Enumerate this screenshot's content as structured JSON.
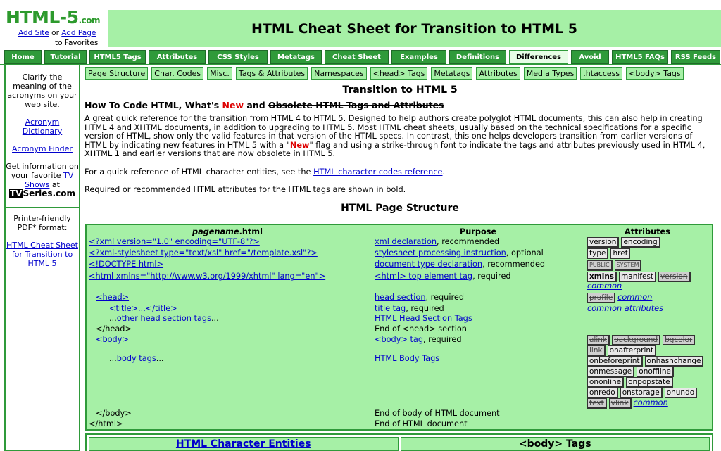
{
  "logo": {
    "brand": "HTML-5",
    "tld": ".com",
    "add_site": "Add Site",
    "or": "or",
    "add_page": "Add Page",
    "favorites": "to Favorites"
  },
  "banner": {
    "title": "HTML Cheat Sheet for Transition to HTML 5"
  },
  "topnav": [
    "Home",
    "Tutorial",
    "HTML5 Tags",
    "Attributes",
    "CSS Styles",
    "Metatags",
    "Cheat Sheet",
    "Examples",
    "Definitions",
    "Differences",
    "Avoid",
    "HTML5 FAQs",
    "RSS Feeds"
  ],
  "topnav_active": "Differences",
  "subnav": [
    "Page Structure",
    "Char. Codes",
    "Misc.",
    "Tags & Attributes",
    "Namespaces",
    "<head> Tags",
    "Metatags",
    "Attributes",
    "Media Types",
    ".htaccess",
    "<body> Tags"
  ],
  "sidebar": {
    "clarify": "Clarify the meaning of the acronyms on your web site.",
    "acronym_dictionary": "Acronym Dictionary",
    "acronym_finder": "Acronym Finder",
    "info_pre": "Get information on your favorite",
    "tv_shows": "TV Shows",
    "info_post": "at",
    "tv_brand_tv": "TV",
    "tv_brand_rest": "Series.com",
    "printer": "Printer-friendly PDF* format:",
    "pdf_link": "HTML Cheat Sheet for Transition to HTML 5"
  },
  "main": {
    "title": "Transition to HTML 5",
    "subtitle_pre": "How To Code HTML, What's",
    "subtitle_new": "New",
    "subtitle_and": "and",
    "subtitle_strike": "Obsolete HTML Tags and Attributes",
    "intro_1": "A great quick reference for the transition from HTML 4 to HTML 5. Designed to help authors create polyglot HTML documents, this can also help in creating HTML 4 and XHTML documents, in addition to upgrading to HTML 5. Most HTML cheat sheets, usually based on the technical specifications for a specific version of HTML, show only the valid features in that version of the HTML specs. In contrast, this one helps developers transition from earlier versions of HTML by indicating new features in HTML 5 with a \"",
    "intro_new": "New",
    "intro_2": "\" flag and using a strike-through font to indicate the tags and attributes previously used in HTML 4, XHTML 1 and earlier versions that are now obsolete in HTML 5.",
    "char_pre": "For a quick reference of HTML character entities, see the",
    "char_link": "HTML character codes reference",
    "char_post": ".",
    "required": "Required or recommended HTML attributes for the HTML tags are shown in bold.",
    "section_title": "HTML Page Structure"
  },
  "table": {
    "head_col1_b": "pagename",
    "head_col1_rest": ".html",
    "head_col2": "Purpose",
    "head_col3": "Attributes",
    "code": {
      "xml": "<?xml version=\"1.0\" encoding=\"UTF-8\"?>",
      "xsl": "<?xml-stylesheet type=\"text/xsl\" href=\"/template.xsl\"?>",
      "doctype": "<!DOCTYPE html>",
      "html": "<html xmlns=\"http://www.w3.org/1999/xhtml\" lang=\"en\">",
      "head": "<head>",
      "title": "<title>...</title>",
      "other_pre": "...",
      "other_link": "other head section tags",
      "other_post": "...",
      "head_close": "</head>",
      "body": "<body>",
      "body_pre": "...",
      "body_link": "body tags",
      "body_post": "...",
      "body_close": "</body>",
      "html_close": "</html>"
    },
    "purpose": {
      "xml_link": "xml declaration",
      "xml_post": ", recommended",
      "xsl_link": "stylesheet processing instruction",
      "xsl_post": ", optional",
      "doctype_link": "document type declaration",
      "doctype_post": ", recommended",
      "html_link": "<html> top element tag",
      "html_post": ", required",
      "head_link": "head section",
      "head_post": ", required",
      "title_link": "title tag",
      "title_post": ", required",
      "head_tags": "HTML Head Section Tags",
      "head_end": "End of <head> section",
      "body_link": "<body> tag",
      "body_post": ", required",
      "body_tags": "HTML Body Tags",
      "body_end": "End of body of HTML document",
      "doc_end": "End of HTML document"
    },
    "attrs": {
      "version": "version",
      "encoding": "encoding",
      "type": "type",
      "href": "href",
      "public": "PUBLIC",
      "system": "SYSTEM",
      "xmlns": "xmlns",
      "manifest": "manifest",
      "version_obs": "version",
      "common": "common",
      "profile": "profile",
      "common2": "common",
      "common_attributes": "common attributes",
      "body_row1": [
        "alink",
        "background",
        "bgcolor"
      ],
      "link": "link",
      "onafterprint": "onafterprint",
      "onbeforeprint": "onbeforeprint",
      "onhashchange": "onhashchange",
      "onmessage": "onmessage",
      "onoffline": "onoffline",
      "ononline": "ononline",
      "onpopstate": "onpopstate",
      "onredo": "onredo",
      "onstorage": "onstorage",
      "onundo": "onundo",
      "text": "text",
      "vlink": "vlink",
      "common3": "common"
    }
  },
  "bottom": {
    "left": "HTML Character Entities",
    "right": "<body> Tags"
  }
}
